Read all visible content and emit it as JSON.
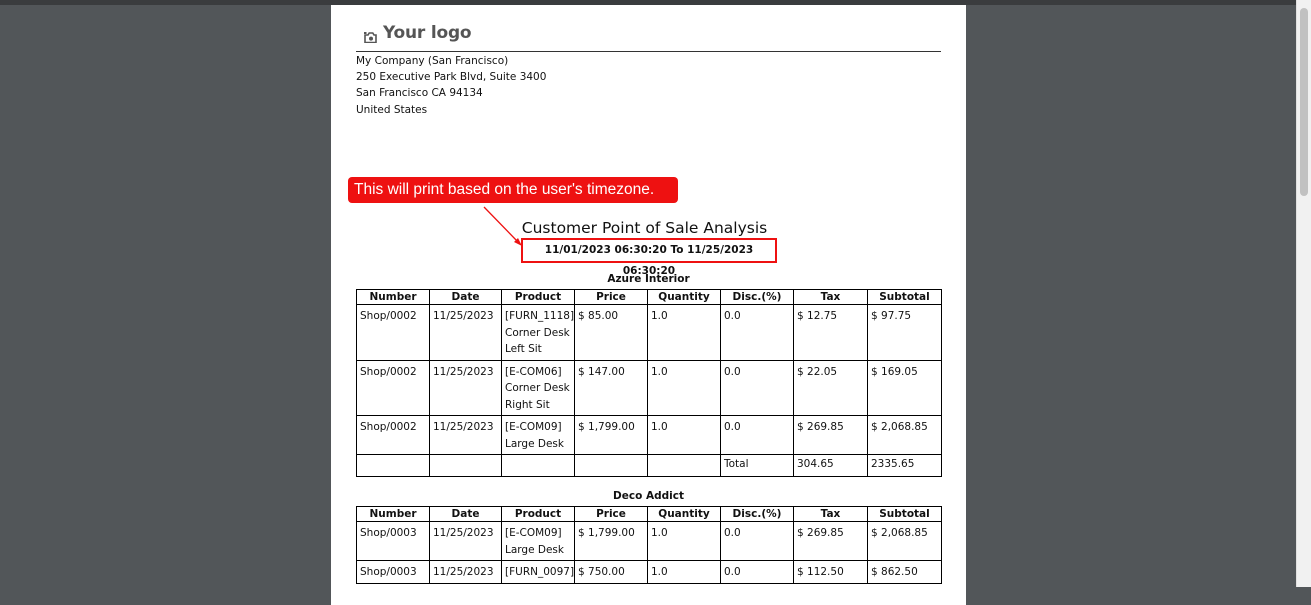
{
  "logo": {
    "text": "Your logo",
    "icon": "camera-icon"
  },
  "company": {
    "name": "My Company (San Francisco)",
    "street": "250 Executive Park Blvd, Suite 3400",
    "city": "San Francisco CA 94134",
    "country": "United States"
  },
  "callout": {
    "text": "This will print based on the user's timezone.",
    "color": "#ee1111"
  },
  "report": {
    "title": "Customer Point of Sale Analysis",
    "date_range": "11/01/2023 06:30:20 To 11/25/2023 06:30:20"
  },
  "columns": [
    "Number",
    "Date",
    "Product",
    "Price",
    "Quantity",
    "Disc.(%)",
    "Tax",
    "Subtotal"
  ],
  "customers": [
    {
      "name": "Azure Interior",
      "rows": [
        {
          "number": "Shop/0002",
          "date": "11/25/2023",
          "product": [
            "[FURN_1118]",
            "Corner Desk",
            "Left Sit"
          ],
          "price": "$ 85.00",
          "qty": "1.0",
          "disc": "0.0",
          "tax": "$ 12.75",
          "subtotal": "$ 97.75"
        },
        {
          "number": "Shop/0002",
          "date": "11/25/2023",
          "product": [
            "[E-COM06]",
            "Corner Desk",
            "Right Sit"
          ],
          "price": "$ 147.00",
          "qty": "1.0",
          "disc": "0.0",
          "tax": "$ 22.05",
          "subtotal": "$ 169.05"
        },
        {
          "number": "Shop/0002",
          "date": "11/25/2023",
          "product": [
            "[E-COM09]",
            "Large Desk"
          ],
          "price": "$ 1,799.00",
          "qty": "1.0",
          "disc": "0.0",
          "tax": "$ 269.85",
          "subtotal": "$ 2,068.85"
        }
      ],
      "total": {
        "label": "Total",
        "tax": "304.65",
        "subtotal": "2335.65"
      }
    },
    {
      "name": "Deco Addict",
      "rows": [
        {
          "number": "Shop/0003",
          "date": "11/25/2023",
          "product": [
            "[E-COM09]",
            "Large Desk"
          ],
          "price": "$ 1,799.00",
          "qty": "1.0",
          "disc": "0.0",
          "tax": "$ 269.85",
          "subtotal": "$ 2,068.85"
        },
        {
          "number": "Shop/0003",
          "date": "11/25/2023",
          "product": [
            "[FURN_0097]"
          ],
          "price": "$ 750.00",
          "qty": "1.0",
          "disc": "0.0",
          "tax": "$ 112.50",
          "subtotal": "$ 862.50"
        }
      ]
    }
  ]
}
